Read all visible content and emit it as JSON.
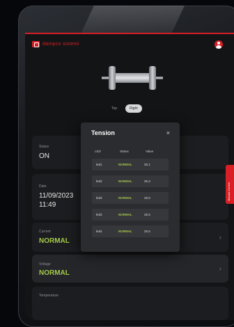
{
  "brand": {
    "name": "dampco sistemi",
    "color": "#d81f26"
  },
  "view_toggle": [
    {
      "label": "Top",
      "active": false
    },
    {
      "label": "Right",
      "active": true
    }
  ],
  "cards": {
    "status": {
      "label": "Status",
      "value": "ON"
    },
    "date": {
      "label": "Date",
      "date": "11/09/2023",
      "time": "11:49"
    },
    "current": {
      "label": "Current",
      "value": "NORMAL"
    },
    "voltage": {
      "label": "Voltage",
      "value": "NORMAL"
    },
    "temperature": {
      "label": "Temperature"
    }
  },
  "side_tab": {
    "label": "Manual Control"
  },
  "modal": {
    "title": "Tension",
    "close": "×",
    "columns": [
      "LED",
      "Status",
      "Value"
    ],
    "rows": [
      {
        "led": "led1",
        "status": "NORMAL",
        "value": "25.1"
      },
      {
        "led": "led2",
        "status": "NORMAL",
        "value": "25.3"
      },
      {
        "led": "led3",
        "status": "NORMAL",
        "value": "25.5"
      },
      {
        "led": "led3",
        "status": "NORMAL",
        "value": "25.5"
      },
      {
        "led": "led4",
        "status": "NORMAL",
        "value": "25.5"
      }
    ]
  },
  "colors": {
    "ok": "#a4c84a",
    "panel": "#2b2c2f"
  },
  "icons": [
    "user-icon",
    "close-icon",
    "chevron-right-icon"
  ]
}
